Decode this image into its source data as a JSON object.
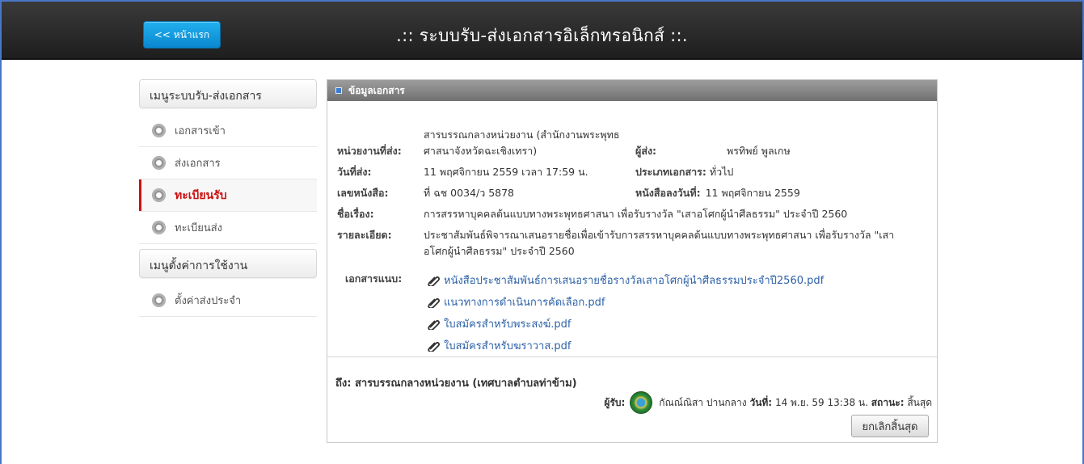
{
  "header": {
    "home_label": "<< หน้าแรก",
    "title": ".:: ระบบรับ-ส่งเอกสารอิเล็กทรอนิกส์ ::."
  },
  "sidebar": {
    "section1_title": "เมนูระบบรับ-ส่งเอกสาร",
    "section1_items": [
      "เอกสารเข้า",
      "ส่งเอกสาร",
      "ทะเบียนรับ",
      "ทะเบียนส่ง"
    ],
    "active_item": "ทะเบียนรับ",
    "section2_title": "เมนูตั้งค่าการใช้งาน",
    "section2_items": [
      "ตั้งค่าส่งประจำ"
    ]
  },
  "panel": {
    "title": "ข้อมูลเอกสาร",
    "sender_unit_label": "หน่วยงานที่ส่ง:",
    "sender_unit_line1": "สารบรรณกลางหน่วยงาน (สำนักงานพระพุทธ",
    "sender_unit_line2": "ศาสนาจังหวัดฉะเชิงเทรา)",
    "sender_label": "ผู้ส่ง:",
    "sender_name": "พรทิพย์ พูลเกษ",
    "send_date_label": "วันที่ส่ง:",
    "send_date": "11 พฤศจิกายน 2559 เวลา 17:59 น.",
    "doc_type_label": "ประเภทเอกสาร:",
    "doc_type": "ทั่วไป",
    "doc_no_label": "เลขหนังสือ:",
    "doc_no": "ที่ ฉช 0034/ว 5878",
    "doc_date_label": "หนังสือลงวันที่:",
    "doc_date": "11 พฤศจิกายน 2559",
    "subject_label": "ชื่อเรื่อง:",
    "subject": "การสรรหาบุคคลต้นแบบทางพระพุทธศาสนา เพื่อรับรางวัล \"เสาอโศกผู้นำศีลธรรม\" ประจำปี 2560",
    "detail_label": "รายละเอียด:",
    "detail_line1": "ประชาสัมพันธ์พิจารณาเสนอรายชื่อเพื่อเข้ารับการสรรหาบุคคลต้นแบบทางพระพุทธศาสนา เพื่อรับรางวัล \"เสา",
    "detail_line2": "อโศกผู้นำศีลธรรม\" ประจำปี 2560",
    "attach_label": "เอกสารแนบ:",
    "attachments": [
      "หนังสือประชาสัมพันธ์การเสนอรายชื่อรางวัลเสาอโศกผู้นำศีลธรรมประจำปี2560.pdf",
      "แนวทางการดำเนินการคัดเลือก.pdf",
      "ใบสมัครสำหรับพระสงฆ์.pdf",
      "ใบสมัครสำหรับฆราวาส.pdf"
    ],
    "to_line": "ถึง: สารบรรณกลางหน่วยงาน (เทศบาลตำบลท่าข้าม)",
    "receiver_label": "ผู้รับ:",
    "receiver_name": "กัณณ์ณิสา ปานกลาง",
    "recv_date_label": "วันที่:",
    "recv_date": "14 พ.ย. 59 13:38 น.",
    "status_label": "สถานะ:",
    "status": "สิ้นสุด",
    "cancel_label": "ยกเลิกสิ้นสุด"
  }
}
